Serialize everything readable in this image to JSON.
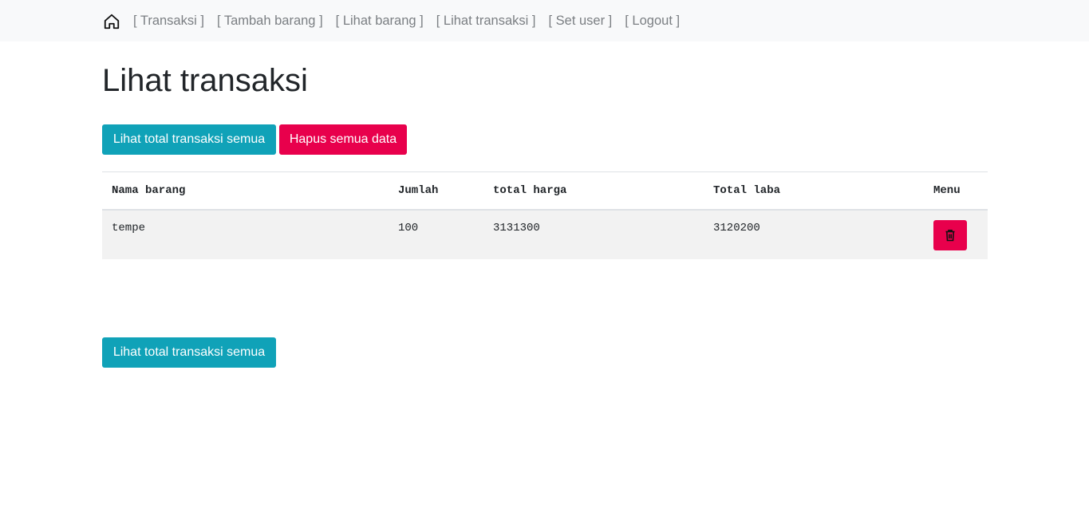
{
  "nav": {
    "home_icon": "house-icon",
    "items": [
      {
        "label": "[ Transaksi ]"
      },
      {
        "label": "[ Tambah barang ]"
      },
      {
        "label": "[ Lihat barang ]"
      },
      {
        "label": "[ Lihat transaksi ]"
      },
      {
        "label": "[ Set user ]"
      },
      {
        "label": "[ Logout ]"
      }
    ]
  },
  "page": {
    "title": "Lihat transaksi"
  },
  "actions": {
    "total_label": "Lihat total transaksi semua",
    "hapus_label": "Hapus semua data"
  },
  "table": {
    "headers": [
      "Nama barang",
      "Jumlah",
      "total harga",
      "Total laba",
      "Menu"
    ],
    "rows": [
      {
        "nama": "tempe",
        "jumlah": "100",
        "total_harga": "3131300",
        "total_laba": "3120200",
        "menu_icon": "trash-icon"
      }
    ]
  },
  "colors": {
    "info": "#10a2b8",
    "danger": "#e8004c",
    "navbar_bg": "#f8f9fa"
  }
}
